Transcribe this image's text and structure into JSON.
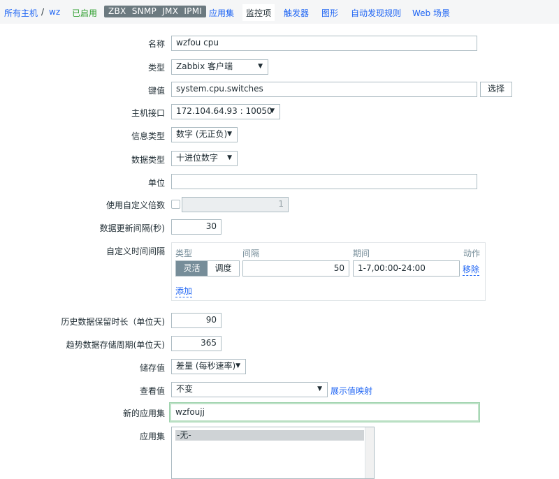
{
  "nav": {
    "all_hosts": "所有主机",
    "host": "wz",
    "status": "已启用",
    "availability": [
      "ZBX",
      "SNMP",
      "JMX",
      "IPMI"
    ],
    "tabs": [
      "应用集",
      "监控项",
      "触发器",
      "图形",
      "自动发现规则",
      "Web 场景"
    ],
    "active_tab": "监控项"
  },
  "form": {
    "name": {
      "label": "名称",
      "value": "wzfou cpu"
    },
    "type": {
      "label": "类型",
      "value": "Zabbix 客户端"
    },
    "key": {
      "label": "键值",
      "value": "system.cpu.switches",
      "button": "选择"
    },
    "interface": {
      "label": "主机接口",
      "value": "172.104.64.93 : 10050"
    },
    "info_type": {
      "label": "信息类型",
      "value": "数字 (无正负)"
    },
    "data_type": {
      "label": "数据类型",
      "value": "十进位数字"
    },
    "units": {
      "label": "单位",
      "value": ""
    },
    "multiplier": {
      "label": "使用自定义倍数",
      "checked": false,
      "value": "1"
    },
    "update_interval": {
      "label": "数据更新间隔(秒)",
      "value": "30"
    },
    "custom_intervals": {
      "label": "自定义时间间隔",
      "headers": {
        "type": "类型",
        "interval": "间隔",
        "period": "期间",
        "action": "动作"
      },
      "mode_options": [
        "灵活",
        "调度"
      ],
      "active_mode": "灵活",
      "interval": "50",
      "period": "1-7,00:00-24:00",
      "remove": "移除",
      "add": "添加"
    },
    "history": {
      "label": "历史数据保留时长（单位天)",
      "value": "90"
    },
    "trends": {
      "label": "趋势数据存储周期(单位天)",
      "value": "365"
    },
    "store_value": {
      "label": "储存值",
      "value": "差量 (每秒速率)"
    },
    "show_value": {
      "label": "查看值",
      "value": "不变",
      "link": "展示值映射"
    },
    "new_application": {
      "label": "新的应用集",
      "value": "wzfoujj"
    },
    "applications": {
      "label": "应用集",
      "options": [
        "-无-"
      ]
    }
  }
}
